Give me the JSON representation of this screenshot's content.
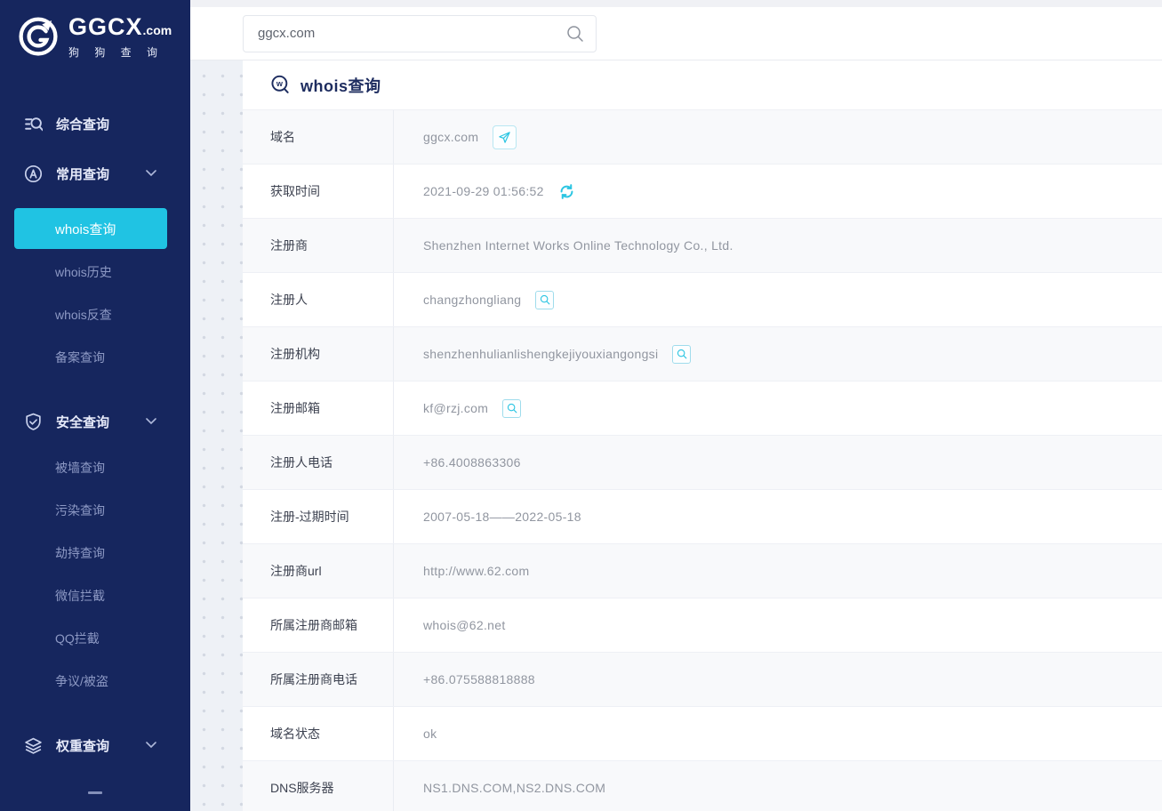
{
  "colors": {
    "sidebar_navy": "#16265e",
    "accent_cyan": "#20c3e3",
    "title_navy": "#1d2c5f",
    "row_alt_gray": "#f8f9fb"
  },
  "brand": {
    "name": "GGCX",
    "suffix": ".com",
    "subtitle": "狗 狗 查 询"
  },
  "header": {
    "search_value": "ggcx.com"
  },
  "sidebar": {
    "item_comprehensive": "综合查询",
    "groups": [
      {
        "label": "常用查询",
        "items": [
          "whois查询",
          "whois历史",
          "whois反查",
          "备案查询"
        ],
        "active_item": "whois查询"
      },
      {
        "label": "安全查询",
        "items": [
          "被墙查询",
          "污染查询",
          "劫持查询",
          "微信拦截",
          "QQ拦截",
          "争议/被盗"
        ]
      },
      {
        "label": "权重查询",
        "items": []
      }
    ]
  },
  "page": {
    "title": "whois查询"
  },
  "icons": {
    "logo": "dog-logo-icon",
    "comprehensive": "filter-search-icon",
    "common": "circle-a-icon",
    "security": "shield-check-icon",
    "weight": "layers-icon",
    "chevron": "chevron-down-icon",
    "search": "search-icon",
    "title": "whois-magnifier-icon",
    "send": "send-icon",
    "refresh": "refresh-icon",
    "row_search": "search-icon"
  },
  "whois": {
    "rows": [
      {
        "label": "域名",
        "value": "ggcx.com",
        "icon": "send"
      },
      {
        "label": "获取时间",
        "value": "2021-09-29 01:56:52",
        "icon": "refresh"
      },
      {
        "label": "注册商",
        "value": "Shenzhen Internet Works Online Technology Co., Ltd.",
        "icon": null
      },
      {
        "label": "注册人",
        "value": "changzhongliang",
        "icon": "search"
      },
      {
        "label": "注册机构",
        "value": "shenzhenhulianlishengkejiyouxiangongsi",
        "icon": "search"
      },
      {
        "label": "注册邮箱",
        "value": "kf@rzj.com",
        "icon": "search"
      },
      {
        "label": "注册人电话",
        "value": "+86.4008863306",
        "icon": null
      },
      {
        "label": "注册-过期时间",
        "value": "2007-05-18——2022-05-18",
        "icon": null
      },
      {
        "label": "注册商url",
        "value": "http://www.62.com",
        "icon": null
      },
      {
        "label": "所属注册商邮箱",
        "value": "whois@62.net",
        "icon": null
      },
      {
        "label": "所属注册商电话",
        "value": "+86.075588818888",
        "icon": null
      },
      {
        "label": "域名状态",
        "value": "ok",
        "icon": null
      },
      {
        "label": "DNS服务器",
        "value": "NS1.DNS.COM,NS2.DNS.COM",
        "icon": null
      }
    ]
  }
}
